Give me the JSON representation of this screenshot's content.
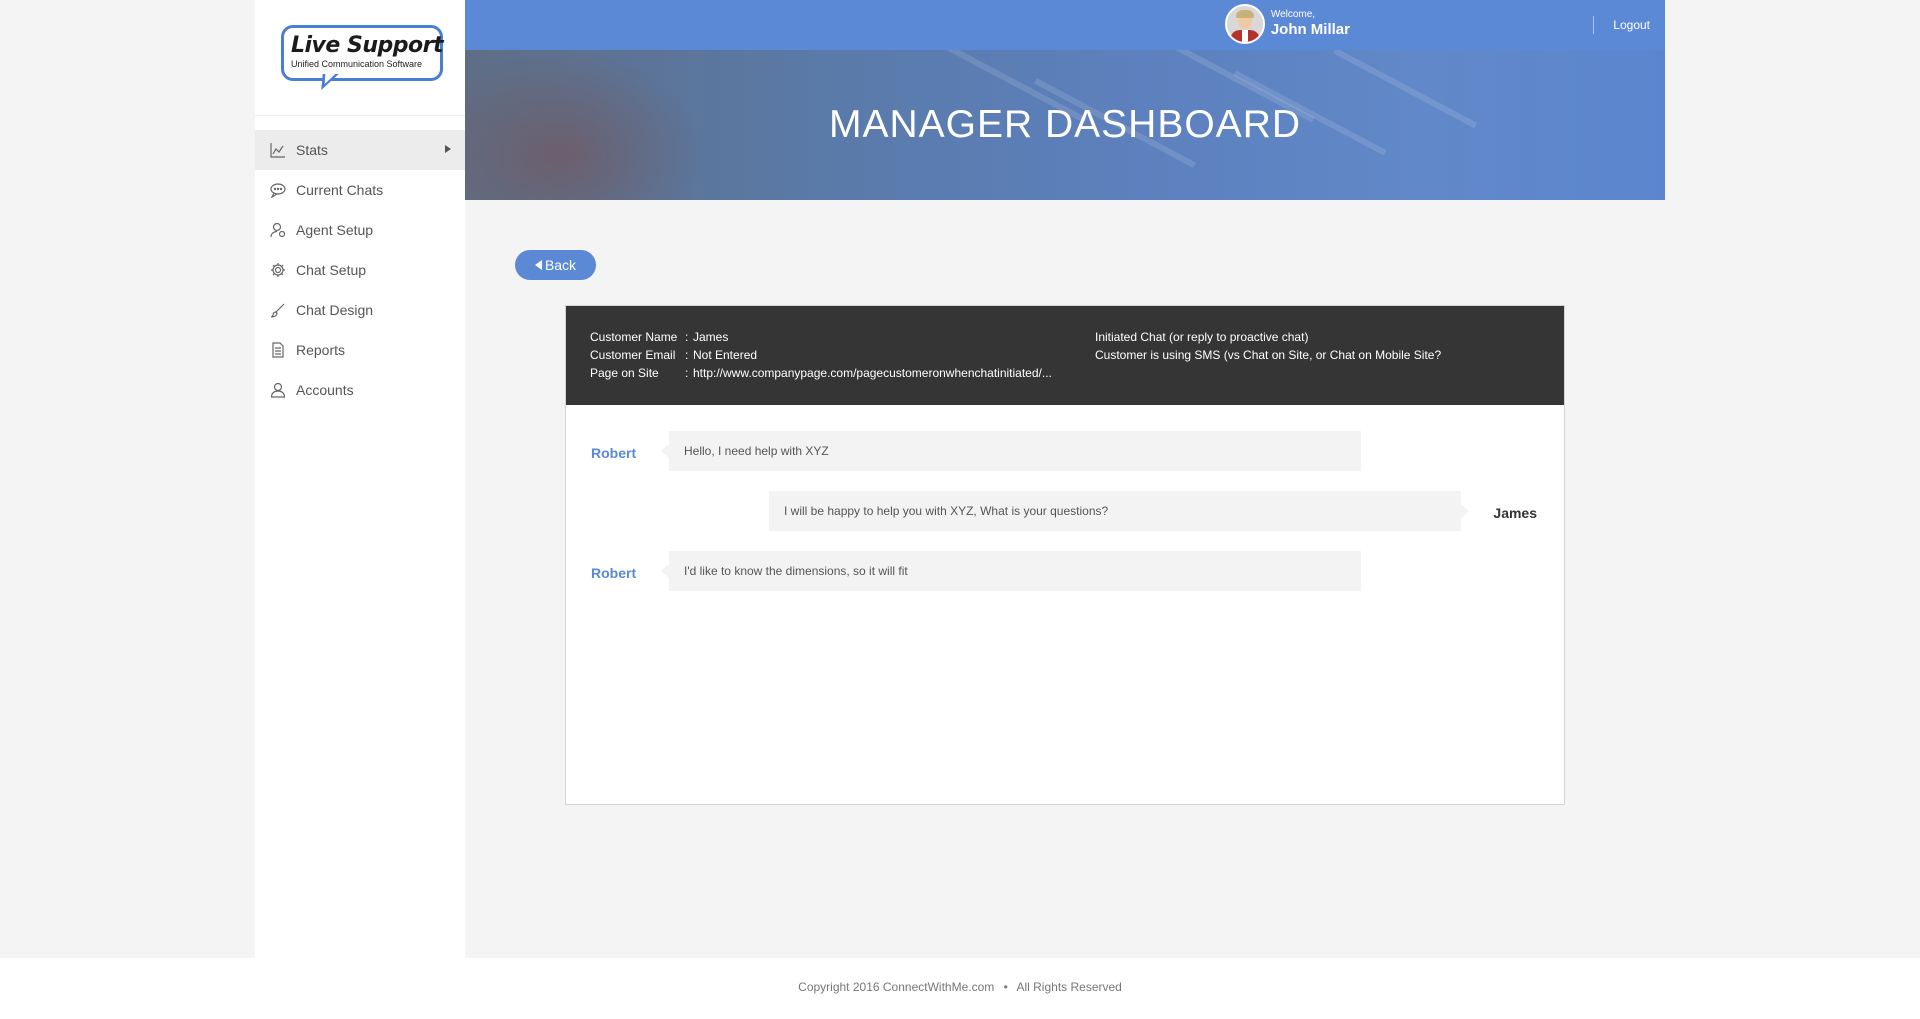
{
  "logo": {
    "title": "Live Support",
    "subtitle": "Unified Communication Software"
  },
  "sidebar": {
    "items": [
      {
        "label": "Stats",
        "icon": "chart-icon",
        "active": true
      },
      {
        "label": "Current Chats",
        "icon": "chat-bubble-icon"
      },
      {
        "label": "Agent Setup",
        "icon": "agent-icon"
      },
      {
        "label": "Chat Setup",
        "icon": "gear-icon"
      },
      {
        "label": "Chat Design",
        "icon": "brush-icon"
      },
      {
        "label": "Reports",
        "icon": "document-icon"
      },
      {
        "label": "Accounts",
        "icon": "user-icon"
      }
    ]
  },
  "header": {
    "title": "MANAGER DASHBOARD",
    "welcome": "Welcome,",
    "user_name": "John Millar",
    "logout": "Logout"
  },
  "back_label": "Back",
  "chat_info": {
    "customer_name_label": "Customer Name",
    "customer_name": "James",
    "customer_email_label": "Customer Email",
    "customer_email": "Not Entered",
    "page_label": "Page on Site",
    "page": "http://www.companypage.com/pagecustomeronwhenchatinitiated/...",
    "colon": ":",
    "initiated": "Initiated Chat (or reply to proactive chat)",
    "channel": "Customer is using SMS (vs Chat on Site, or Chat on Mobile Site?"
  },
  "messages": [
    {
      "sender": "Robert",
      "text": "Hello, I need help with XYZ"
    },
    {
      "sender": "James",
      "text": "I will be happy to help you with XYZ, What is your questions?"
    },
    {
      "sender": "Robert",
      "text": "I'd like to know the dimensions, so it will fit"
    }
  ],
  "footer": {
    "copyright": "Copyright 2016 ConnectWithMe.com",
    "separator": "•",
    "rights": "All Rights Reserved"
  },
  "colors": {
    "accent": "#5b89d6",
    "info_bg": "#353535",
    "sidebar_active": "#ececec"
  }
}
